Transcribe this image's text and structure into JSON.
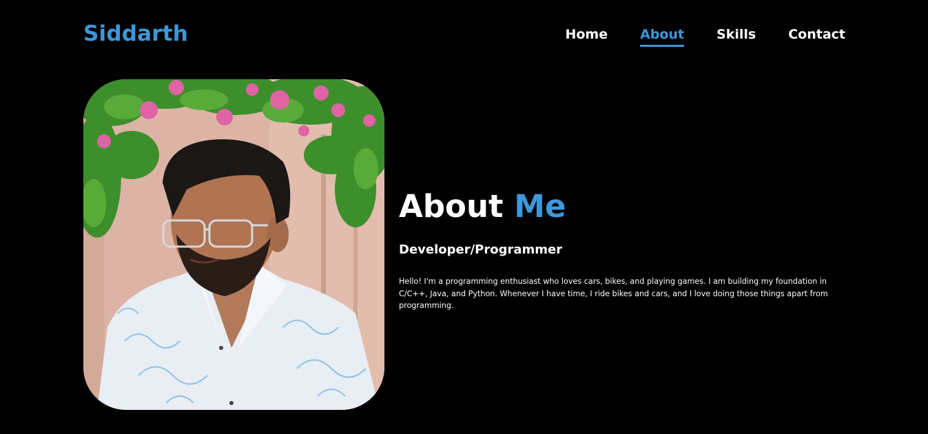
{
  "brand": {
    "logo_text": "Siddarth",
    "accent_color": "#3d97da",
    "background_color": "#000000"
  },
  "nav": {
    "items": [
      {
        "label": "Home",
        "active": false
      },
      {
        "label": "About",
        "active": true
      },
      {
        "label": "Skills",
        "active": false
      },
      {
        "label": "Contact",
        "active": false
      }
    ]
  },
  "about": {
    "title_prefix": "About",
    "title_accent": "Me",
    "subtitle": "Developer/Programmer",
    "description": "Hello! I'm a programming enthusiast who loves cars, bikes, and playing games. I am building my foundation in C/C++, Java, and Python. Whenever I have time, I ride bikes and cars, and I love doing those things apart from programming."
  }
}
